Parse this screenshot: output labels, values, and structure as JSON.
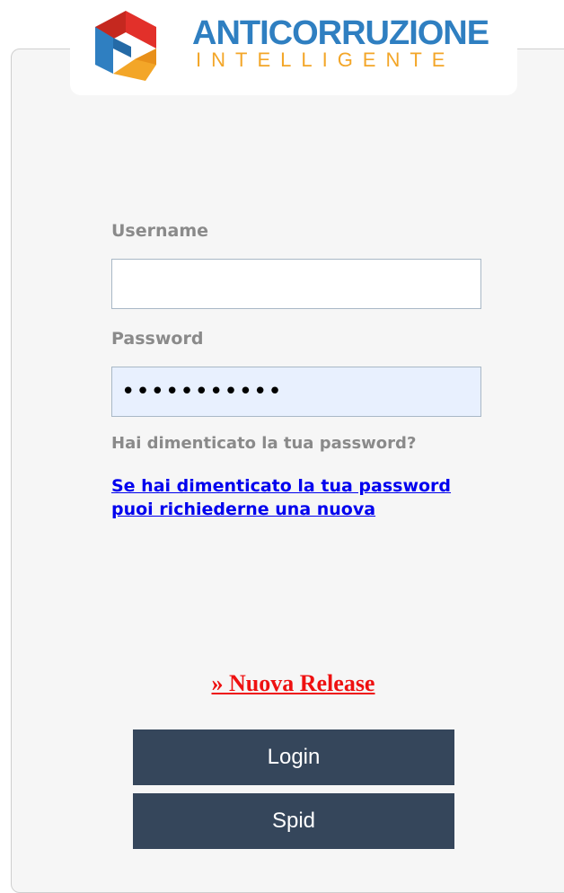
{
  "brand": {
    "line1": "ANTICORRUZIONE",
    "line2": "INTELLIGENTE",
    "colors": {
      "blue": "#2f7fc1",
      "orange": "#f3a628",
      "red": "#e2302a"
    }
  },
  "form": {
    "username_label": "Username",
    "username_value": "",
    "password_label": "Password",
    "password_value": "•••••••••••",
    "forgot_question": "Hai dimenticato la tua password?",
    "forgot_link": "Se hai dimenticato la tua password puoi richiederne una nuova"
  },
  "release_link": "» Nuova Release",
  "buttons": {
    "login": "Login",
    "spid": "Spid"
  }
}
